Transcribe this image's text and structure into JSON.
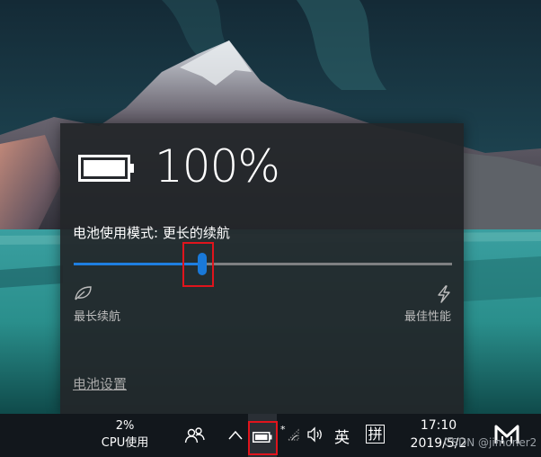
{
  "flyout": {
    "battery_percent": "100%",
    "mode_label": "电池使用模式: 更长的续航",
    "slider_level_percent": 34,
    "left_label": "最长续航",
    "right_label": "最佳性能",
    "settings_link": "电池设置"
  },
  "taskbar": {
    "cpu_percent": "2%",
    "cpu_label": "CPU使用",
    "ime_language": "英",
    "ime_mode": "拼",
    "time": "17:10",
    "date": "2019/5/2",
    "watermark": "CSDN @jimoner2"
  },
  "colors": {
    "accent": "#1979d9",
    "highlight": "#e0141c"
  },
  "icons": [
    "battery-icon",
    "leaf-icon",
    "lightning-icon",
    "people-icon",
    "chevron-up-icon",
    "wifi-icon",
    "volume-icon",
    "app-logo-icon"
  ]
}
